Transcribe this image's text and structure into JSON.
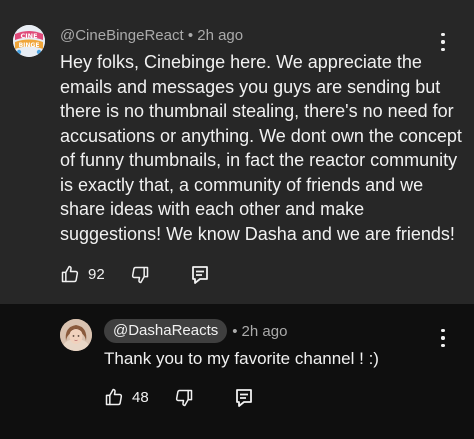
{
  "comment": {
    "author": "@CineBingeReact",
    "time": "2h ago",
    "body": "Hey folks, Cinebinge here. We appreciate the emails and messages you guys are sending but there is no thumbnail stealing, there's no need for accusations or anything. We dont own the concept of funny thumbnails, in fact the reactor community is exactly that, a community of friends and we share ideas with each other and make suggestions! We know Dasha and we are friends!",
    "likes": "92",
    "avatar_logo_text": "CINE BINGE",
    "icons": [
      "thumb-up-icon",
      "thumb-down-icon",
      "reply-icon",
      "more-vert-icon"
    ]
  },
  "reply": {
    "author": "@DashaReacts",
    "time": "2h ago",
    "body": "Thank you to my favorite channel ! :)",
    "likes": "48",
    "icons": [
      "thumb-up-icon",
      "thumb-down-icon",
      "reply-icon",
      "more-vert-icon"
    ]
  },
  "colors": {
    "comment_bg": "#272727",
    "page_bg": "#0f0f0f",
    "secondary_text": "#aaaaaa",
    "chip_bg": "#3f3f3f"
  }
}
